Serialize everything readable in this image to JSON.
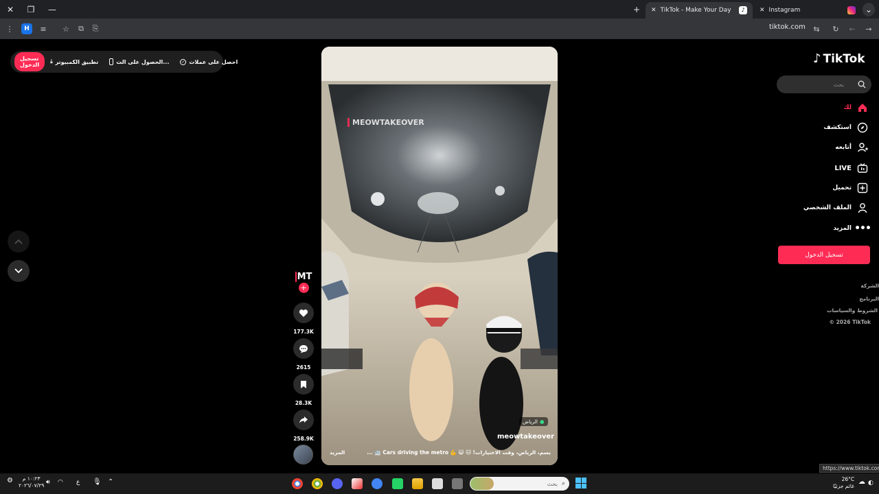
{
  "browser": {
    "tabs": [
      {
        "title": "TikTok - Make Your Day",
        "close": "✕"
      },
      {
        "title": "Instagram",
        "close": "✕"
      }
    ],
    "new_tab": "+",
    "url": "tiktok.com",
    "status_url": "https://www.tiktok.com"
  },
  "topbar": {
    "effects": "احصل على عملات",
    "get_app": "الحصول على الت...",
    "desktop_app": "تطبيق الكمبيوتر",
    "login": "تسجيل الدخول"
  },
  "sidebar": {
    "logo": "TikTok",
    "search_placeholder": "بحث",
    "nav": [
      {
        "label": "لك",
        "icon": "home-icon"
      },
      {
        "label": "استكشف",
        "icon": "compass-icon"
      },
      {
        "label": "أتابعه",
        "icon": "following-icon"
      },
      {
        "label": "LIVE",
        "icon": "live-icon"
      },
      {
        "label": "تحميل",
        "icon": "upload-icon"
      },
      {
        "label": "الملف الشخصي",
        "icon": "profile-icon"
      },
      {
        "label": "المزيد",
        "icon": "more-icon"
      }
    ],
    "login_button": "تسجيل الدخول",
    "footer": [
      "الشركة",
      "البرنامج",
      "الشروط والسياسات",
      "© 2026 TikTok"
    ]
  },
  "video": {
    "watermark": "MEOWTAKEOVER",
    "location": "الرياض",
    "author": "meowtakeover",
    "caption": "بسم، الرياض، وقت الاختيارات! 🐱 😺 💪 Cars driving the metro 🚈 ...",
    "more": "المزيد"
  },
  "actions": {
    "avatar_text": "MT",
    "likes": "177.3K",
    "comments": "2615",
    "saves": "28.3K",
    "shares": "258.9K"
  },
  "taskbar": {
    "search_placeholder": "بحث",
    "weather_temp": "26°C",
    "weather_text": "غائم جزئيًا",
    "time": "١٠:٢٣ م",
    "date": "٢٠٢٦/٠٧/٢٩",
    "lang": "ع"
  },
  "colors": {
    "accent": "#fe2c55",
    "bg": "#000000"
  }
}
